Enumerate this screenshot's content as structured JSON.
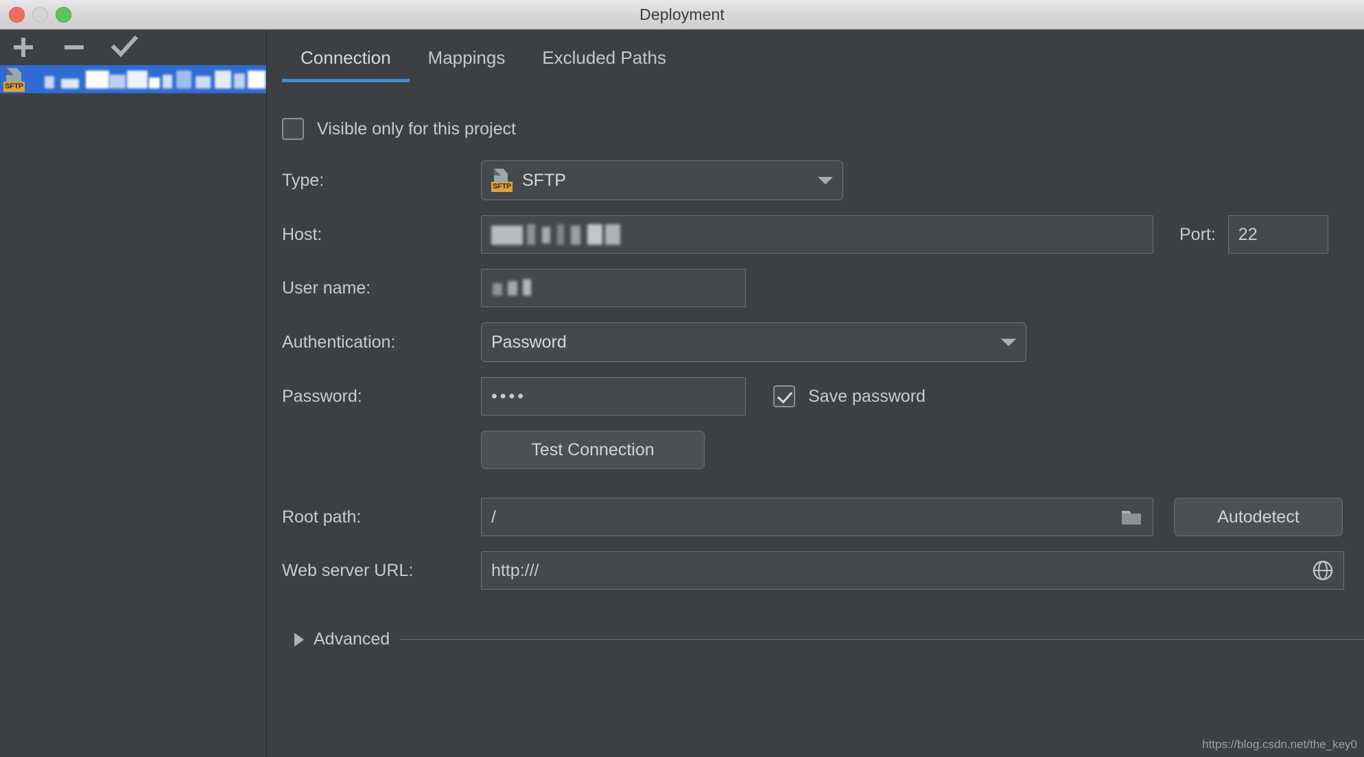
{
  "window": {
    "title": "Deployment",
    "traffic_lights": [
      "close",
      "minimize",
      "maximize"
    ]
  },
  "sidebar": {
    "toolbar": [
      {
        "name": "add",
        "icon": "plus-icon"
      },
      {
        "name": "remove",
        "icon": "minus-icon"
      },
      {
        "name": "set-default",
        "icon": "check-icon"
      }
    ],
    "servers": [
      {
        "type_badge": "SFTP",
        "name": "",
        "redacted": true,
        "selected": true
      }
    ]
  },
  "tabs": [
    {
      "label": "Connection",
      "active": true
    },
    {
      "label": "Mappings",
      "active": false
    },
    {
      "label": "Excluded Paths",
      "active": false
    }
  ],
  "connection": {
    "visible_only": {
      "label": "Visible only for this project",
      "checked": false
    },
    "type": {
      "label": "Type:",
      "value": "SFTP",
      "badge": "SFTP"
    },
    "host": {
      "label": "Host:",
      "value": "",
      "redacted": true
    },
    "port": {
      "label": "Port:",
      "value": "22"
    },
    "user_name": {
      "label": "User name:",
      "value": "",
      "redacted": true
    },
    "authentication": {
      "label": "Authentication:",
      "value": "Password"
    },
    "password": {
      "label": "Password:",
      "value": "••••"
    },
    "save_password": {
      "label": "Save password",
      "checked": true
    },
    "test_connection": {
      "label": "Test Connection"
    },
    "root_path": {
      "label": "Root path:",
      "value": "/",
      "browse_icon": "folder-icon"
    },
    "autodetect": {
      "label": "Autodetect"
    },
    "web_server_url": {
      "label": "Web server URL:",
      "value": "http:///",
      "open_icon": "globe-icon"
    },
    "advanced": {
      "label": "Advanced",
      "expanded": false
    }
  },
  "watermark": "https://blog.csdn.net/the_key0",
  "colors": {
    "window_bg": "#3c4043",
    "selection_blue": "#2f6bd0",
    "tab_underline": "#4a88c7",
    "badge_gold": "#d9a441",
    "field_bg": "#45494c",
    "text": "#c9cbcd"
  }
}
